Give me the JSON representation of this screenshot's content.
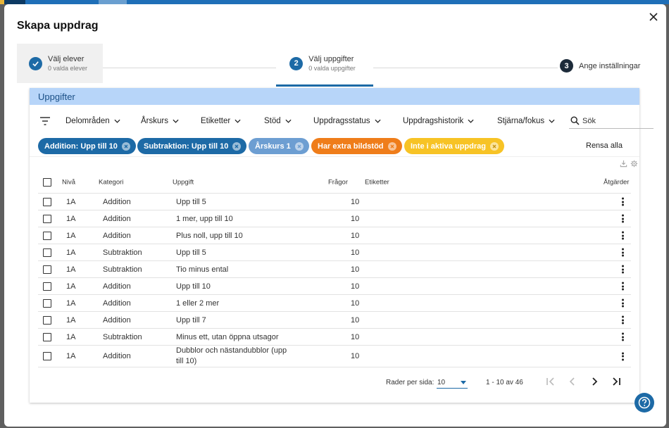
{
  "dialog": {
    "title": "Skapa uppdrag"
  },
  "stepper": {
    "steps": [
      {
        "number": "",
        "title": "Välj elever",
        "subtitle": "0 valda elever",
        "state": "done"
      },
      {
        "number": "2",
        "title": "Välj uppgifter",
        "subtitle": "0 valda uppgifter",
        "state": "active"
      },
      {
        "number": "3",
        "title": "Ange inställningar",
        "subtitle": "",
        "state": "todo"
      }
    ]
  },
  "panel": {
    "title": "Uppgifter"
  },
  "filters": [
    "Delområden",
    "Årskurs",
    "Etiketter",
    "Stöd",
    "Uppdragsstatus",
    "Uppdragshistorik",
    "Stjärna/fokus"
  ],
  "search": {
    "placeholder": "Sök",
    "value": ""
  },
  "chips": [
    {
      "label": "Addition: Upp till 10",
      "color": "#1d6aa6"
    },
    {
      "label": "Subtraktion: Upp till 10",
      "color": "#1d6aa6"
    },
    {
      "label": "Årskurs 1",
      "color": "#6d9ed2"
    },
    {
      "label": "Har extra bildstöd",
      "color": "#ef7d1a"
    },
    {
      "label": "Inte i aktiva uppdrag",
      "color": "#f7c325"
    }
  ],
  "clear_all": "Rensa alla",
  "table": {
    "columns": {
      "level": "Nivå",
      "category": "Kategori",
      "task": "Uppgift",
      "questions": "Frågor",
      "tags": "Etiketter",
      "actions": "Åtgärder"
    },
    "rows": [
      {
        "level": "1A",
        "category": "Addition",
        "task": "Upp till 5",
        "questions": "10",
        "tags": ""
      },
      {
        "level": "1A",
        "category": "Addition",
        "task": "1 mer, upp till 10",
        "questions": "10",
        "tags": ""
      },
      {
        "level": "1A",
        "category": "Addition",
        "task": "Plus noll, upp till 10",
        "questions": "10",
        "tags": ""
      },
      {
        "level": "1A",
        "category": "Subtraktion",
        "task": "Upp till 5",
        "questions": "10",
        "tags": ""
      },
      {
        "level": "1A",
        "category": "Subtraktion",
        "task": "Tio minus ental",
        "questions": "10",
        "tags": ""
      },
      {
        "level": "1A",
        "category": "Addition",
        "task": "Upp till 10",
        "questions": "10",
        "tags": ""
      },
      {
        "level": "1A",
        "category": "Addition",
        "task": "1 eller 2 mer",
        "questions": "10",
        "tags": ""
      },
      {
        "level": "1A",
        "category": "Addition",
        "task": "Upp till 7",
        "questions": "10",
        "tags": ""
      },
      {
        "level": "1A",
        "category": "Subtraktion",
        "task": "Minus ett, utan öppna utsagor",
        "questions": "10",
        "tags": ""
      },
      {
        "level": "1A",
        "category": "Addition",
        "task": "Dubblor och nästandubblor (upp till 10)",
        "questions": "10",
        "tags": ""
      }
    ]
  },
  "pagination": {
    "rows_per_page_label": "Rader per sida:",
    "rows_per_page": "10",
    "range": "1 - 10 av 46"
  },
  "colors": {
    "primary": "#1d6aa6",
    "header_bg": "#b7d5f9",
    "step_todo": "#1d2b3a"
  },
  "icons": [
    "close-icon",
    "check-icon",
    "filter-icon",
    "chevron-down-icon",
    "search-icon",
    "x-circle-icon",
    "download-icon",
    "gear-icon",
    "kebab-icon",
    "first-page-icon",
    "prev-page-icon",
    "next-page-icon",
    "last-page-icon",
    "help-icon"
  ]
}
